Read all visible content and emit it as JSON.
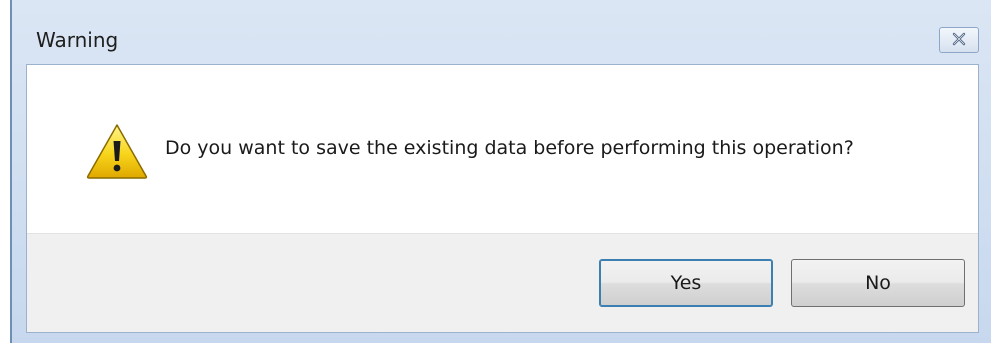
{
  "window": {
    "title": "Warning",
    "close_icon": "close-icon"
  },
  "dialog": {
    "icon": "warning-icon",
    "message": "Do you want to save the existing data before performing this operation?"
  },
  "buttons": {
    "yes_label": "Yes",
    "no_label": "No"
  },
  "colors": {
    "titlebar": "#c7d8ee",
    "button_area": "#f0f0f0",
    "warning_yellow": "#f5d20c"
  }
}
